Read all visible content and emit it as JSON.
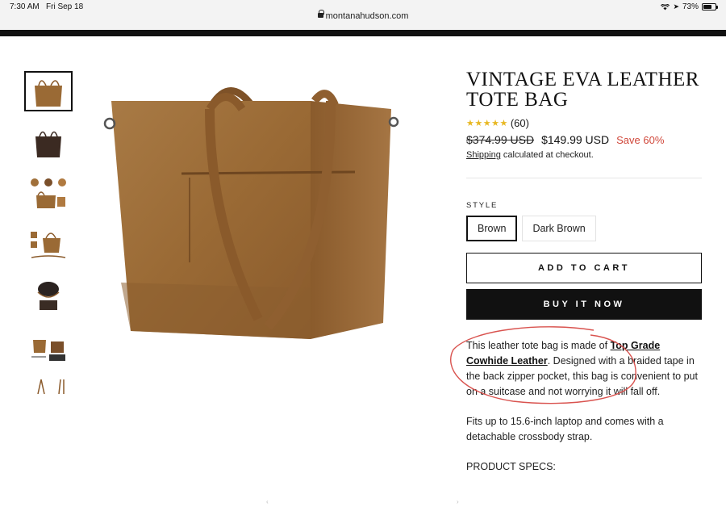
{
  "status": {
    "time": "7:30 AM",
    "date": "Fri Sep 18",
    "battery": "73%",
    "battery_level": 0.73
  },
  "browser": {
    "url": "montanahudson.com"
  },
  "gallery": {
    "thumbnails": [
      {
        "name": "brown-tote-front"
      },
      {
        "name": "dark-brown-tote"
      },
      {
        "name": "detail-views"
      },
      {
        "name": "tote-with-strap"
      },
      {
        "name": "interior-view"
      },
      {
        "name": "tote-with-laptop"
      },
      {
        "name": "strap-view"
      }
    ],
    "active_index": 0
  },
  "product": {
    "title": "VINTAGE EVA LEATHER TOTE BAG",
    "stars": "★★★★★",
    "rating": 5,
    "review_count": "(60)",
    "old_price": "$374.99 USD",
    "new_price": "$149.99 USD",
    "save": "Save 60%",
    "shipping_link": "Shipping",
    "shipping_rest": " calculated at checkout.",
    "style_label": "STYLE",
    "style_options": [
      "Brown",
      "Dark Brown"
    ],
    "selected_style": "Brown",
    "add_to_cart": "ADD TO CART",
    "buy_now": "BUY IT NOW",
    "desc_1a": "This leather tote bag is made of ",
    "desc_1b": "Top Grade Cowhide Leather",
    "desc_1c": ". Designed with a braided tape in the back zipper pocket, this bag is convenient to put on a suitcase and not worrying it will fall off.",
    "desc_2": "Fits up to 15.6-inch laptop and comes with a detachable crossbody strap.",
    "specs_heading": "PRODUCT SPECS:"
  },
  "colors": {
    "leather": "#9a6a35",
    "dark_leather": "#3b2a22",
    "save_red": "#d0473a",
    "star_gold": "#e8b824",
    "annotation_red": "#d9534f"
  }
}
